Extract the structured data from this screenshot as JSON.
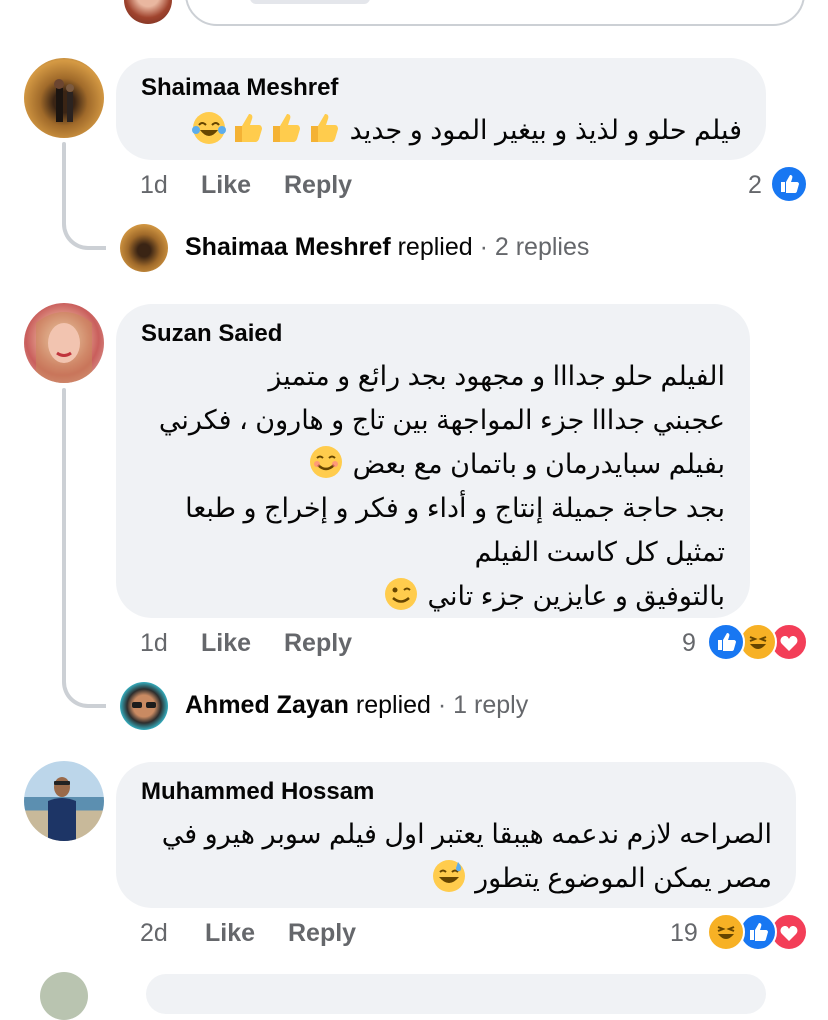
{
  "comments": [
    {
      "author": "Shaimaa Meshref",
      "text_lines": [
        "فيلم حلو و لذيذ و بيغير المود و جديد"
      ],
      "time": "1d",
      "like": "Like",
      "reply": "Reply",
      "reaction_count": "2",
      "reactions": [
        "like"
      ],
      "reply_summary": {
        "name": "Shaimaa Meshref",
        "word": "replied",
        "count": "· 2 replies"
      }
    },
    {
      "author": "Suzan Saied",
      "text_lines": [
        "الفيلم حلو جدااا و مجهود بجد رائع و متميز",
        "عجبني جدااا جزء المواجهة بين تاج و هارون ، فكرني",
        "بفيلم سبايدرمان و باتمان مع بعض",
        "بجد حاجة جميلة إنتاج و أداء و فكر و إخراج و طبعا",
        "تمثيل كل كاست الفيلم",
        "بالتوفيق و عايزين جزء تاني"
      ],
      "time": "1d",
      "like": "Like",
      "reply": "Reply",
      "reaction_count": "9",
      "reactions": [
        "like",
        "haha",
        "love"
      ],
      "reply_summary": {
        "name": "Ahmed Zayan",
        "word": "replied",
        "count": "· 1 reply"
      }
    },
    {
      "author": "Muhammed Hossam",
      "text_lines": [
        "الصراحه لازم ندعمه هيبقا يعتبر اول فيلم سوبر هيرو في",
        "مصر يمكن الموضوع يتطور"
      ],
      "time": "2d",
      "like": "Like",
      "reply": "Reply",
      "reaction_count": "19",
      "reactions": [
        "haha",
        "like",
        "love"
      ]
    }
  ],
  "colors": {
    "bubble": "#f0f2f5",
    "secondary_text": "#65676b",
    "like_blue": "#1877f2",
    "love_red": "#f33e58",
    "haha_yellow": "#f7b125",
    "thread_line": "#ccd0d5"
  },
  "icons": {
    "like": "thumbs-up-icon",
    "haha": "laughing-face-icon",
    "love": "heart-icon"
  }
}
